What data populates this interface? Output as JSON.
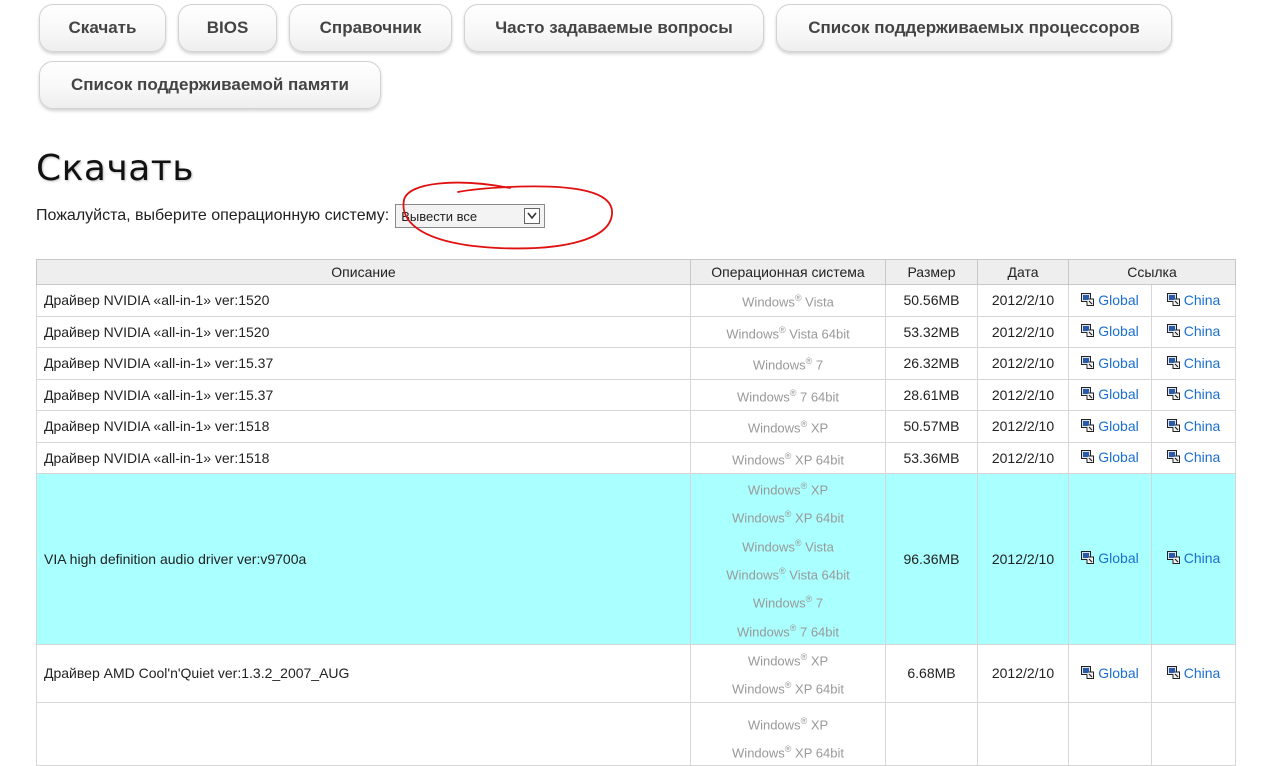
{
  "tabs": [
    {
      "label": "Скачать"
    },
    {
      "label": "BIOS"
    },
    {
      "label": "Справочник"
    },
    {
      "label": "Часто задаваемые вопросы"
    },
    {
      "label": "Список поддерживаемых процессоров"
    },
    {
      "label": "Список поддерживаемой памяти"
    }
  ],
  "page_title": "Скачать",
  "os_filter": {
    "label": "Пожалуйста, выберите операционную систему:",
    "selected": "Вывести все"
  },
  "table": {
    "headers": {
      "description": "Описание",
      "os": "Операционная система",
      "size": "Размер",
      "date": "Дата",
      "link": "Ссылка"
    },
    "rows": [
      {
        "description": "Драйвер NVIDIA «all-in-1» ver:1520",
        "os": [
          {
            "prefix": "Windows",
            "suffix": " Vista"
          }
        ],
        "size": "50.56MB",
        "date": "2012/2/10",
        "link_global": "Global",
        "link_china": "China"
      },
      {
        "description": "Драйвер NVIDIA «all-in-1» ver:1520",
        "os": [
          {
            "prefix": "Windows",
            "suffix": " Vista 64bit"
          }
        ],
        "size": "53.32MB",
        "date": "2012/2/10",
        "link_global": "Global",
        "link_china": "China"
      },
      {
        "description": "Драйвер NVIDIA «all-in-1» ver:15.37",
        "os": [
          {
            "prefix": "Windows",
            "suffix": " 7"
          }
        ],
        "size": "26.32MB",
        "date": "2012/2/10",
        "link_global": "Global",
        "link_china": "China"
      },
      {
        "description": "Драйвер NVIDIA «all-in-1» ver:15.37",
        "os": [
          {
            "prefix": "Windows",
            "suffix": " 7 64bit"
          }
        ],
        "size": "28.61MB",
        "date": "2012/2/10",
        "link_global": "Global",
        "link_china": "China"
      },
      {
        "description": "Драйвер NVIDIA «all-in-1» ver:1518",
        "os": [
          {
            "prefix": "Windows",
            "suffix": " XP"
          }
        ],
        "size": "50.57MB",
        "date": "2012/2/10",
        "link_global": "Global",
        "link_china": "China"
      },
      {
        "description": "Драйвер NVIDIA «all-in-1» ver:1518",
        "os": [
          {
            "prefix": "Windows",
            "suffix": " XP 64bit"
          }
        ],
        "size": "53.36MB",
        "date": "2012/2/10",
        "link_global": "Global",
        "link_china": "China"
      },
      {
        "description": "VIA high definition audio driver ver:v9700a",
        "highlighted": true,
        "os": [
          {
            "prefix": "Windows",
            "suffix": " XP"
          },
          {
            "prefix": "Windows",
            "suffix": " XP 64bit"
          },
          {
            "prefix": "Windows",
            "suffix": " Vista"
          },
          {
            "prefix": "Windows",
            "suffix": " Vista 64bit"
          },
          {
            "prefix": "Windows",
            "suffix": " 7"
          },
          {
            "prefix": "Windows",
            "suffix": " 7 64bit"
          }
        ],
        "size": "96.36MB",
        "date": "2012/2/10",
        "link_global": "Global",
        "link_china": "China"
      },
      {
        "description": "Драйвер AMD Cool'n'Quiet ver:1.3.2_2007_AUG",
        "os": [
          {
            "prefix": "Windows",
            "suffix": " XP"
          },
          {
            "prefix": "Windows",
            "suffix": " XP 64bit"
          }
        ],
        "size": "6.68MB",
        "date": "2012/2/10",
        "link_global": "Global",
        "link_china": "China"
      },
      {
        "description": "",
        "os": [
          {
            "prefix": "Windows",
            "suffix": " XP"
          },
          {
            "prefix": "Windows",
            "suffix": " XP 64bit"
          }
        ],
        "size": "",
        "date": "",
        "link_global": "",
        "link_china": ""
      }
    ],
    "registered_mark": "®"
  },
  "colors": {
    "highlight": "#aaffff",
    "link": "#1a6fd0",
    "annotation": "#e01010"
  }
}
